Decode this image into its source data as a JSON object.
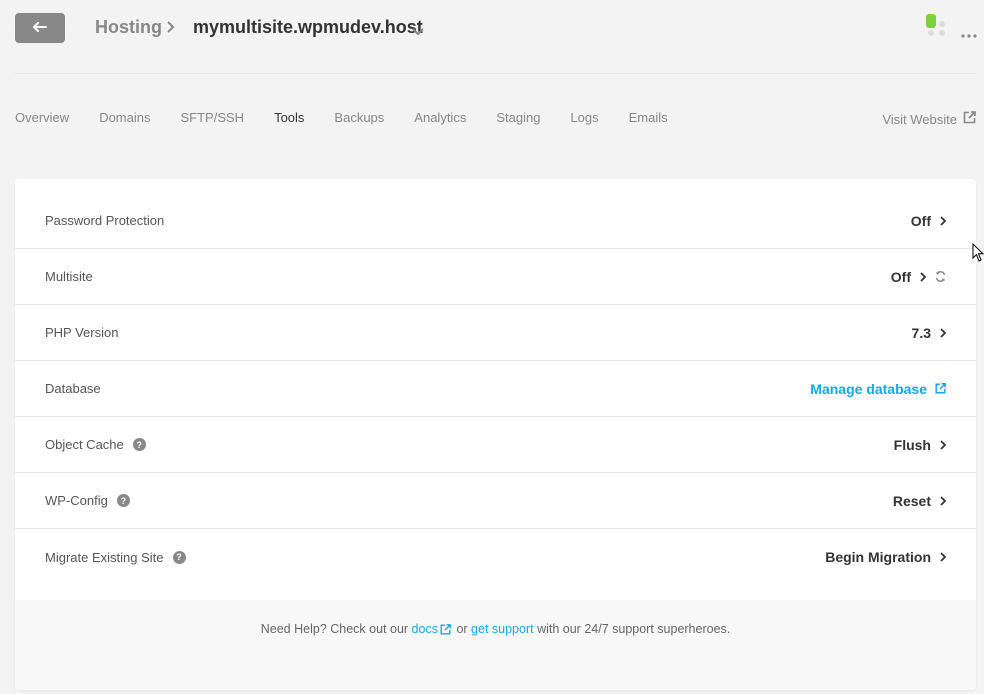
{
  "header": {
    "breadcrumb_root": "Hosting",
    "site_name": "mymultisite.wpmudev.host",
    "icons": {
      "back": "back-arrow-icon",
      "separator": "chevron-right-icon",
      "site_dropdown": "chevron-down-icon",
      "status": "server-status-icon",
      "more": "more-dots-icon"
    }
  },
  "tabs": [
    {
      "label": "Overview",
      "active": false
    },
    {
      "label": "Domains",
      "active": false
    },
    {
      "label": "SFTP/SSH",
      "active": false
    },
    {
      "label": "Tools",
      "active": true
    },
    {
      "label": "Backups",
      "active": false
    },
    {
      "label": "Analytics",
      "active": false
    },
    {
      "label": "Staging",
      "active": false
    },
    {
      "label": "Logs",
      "active": false
    },
    {
      "label": "Emails",
      "active": false
    }
  ],
  "visit_website": "Visit Website",
  "tools": [
    {
      "label": "Password Protection",
      "action": "Off",
      "help": false
    },
    {
      "label": "Multisite",
      "action": "Off",
      "help": false,
      "refresh": true
    },
    {
      "label": "PHP Version",
      "action": "7.3",
      "help": false
    },
    {
      "label": "Database",
      "action": "Manage database",
      "help": false,
      "external": true
    },
    {
      "label": "Object Cache",
      "action": "Flush",
      "help": true
    },
    {
      "label": "WP-Config",
      "action": "Reset",
      "help": true
    },
    {
      "label": "Migrate Existing Site",
      "action": "Begin Migration",
      "help": true
    }
  ],
  "help_footer": {
    "prefix": "Need Help? Check out our",
    "docs_link": "docs",
    "middle": "or",
    "support_link": "get support",
    "suffix": "with our 24/7 support superheroes."
  },
  "colors": {
    "accent": "#17a8e3",
    "back_button": "#888888",
    "status_green": "#7fd13b"
  }
}
